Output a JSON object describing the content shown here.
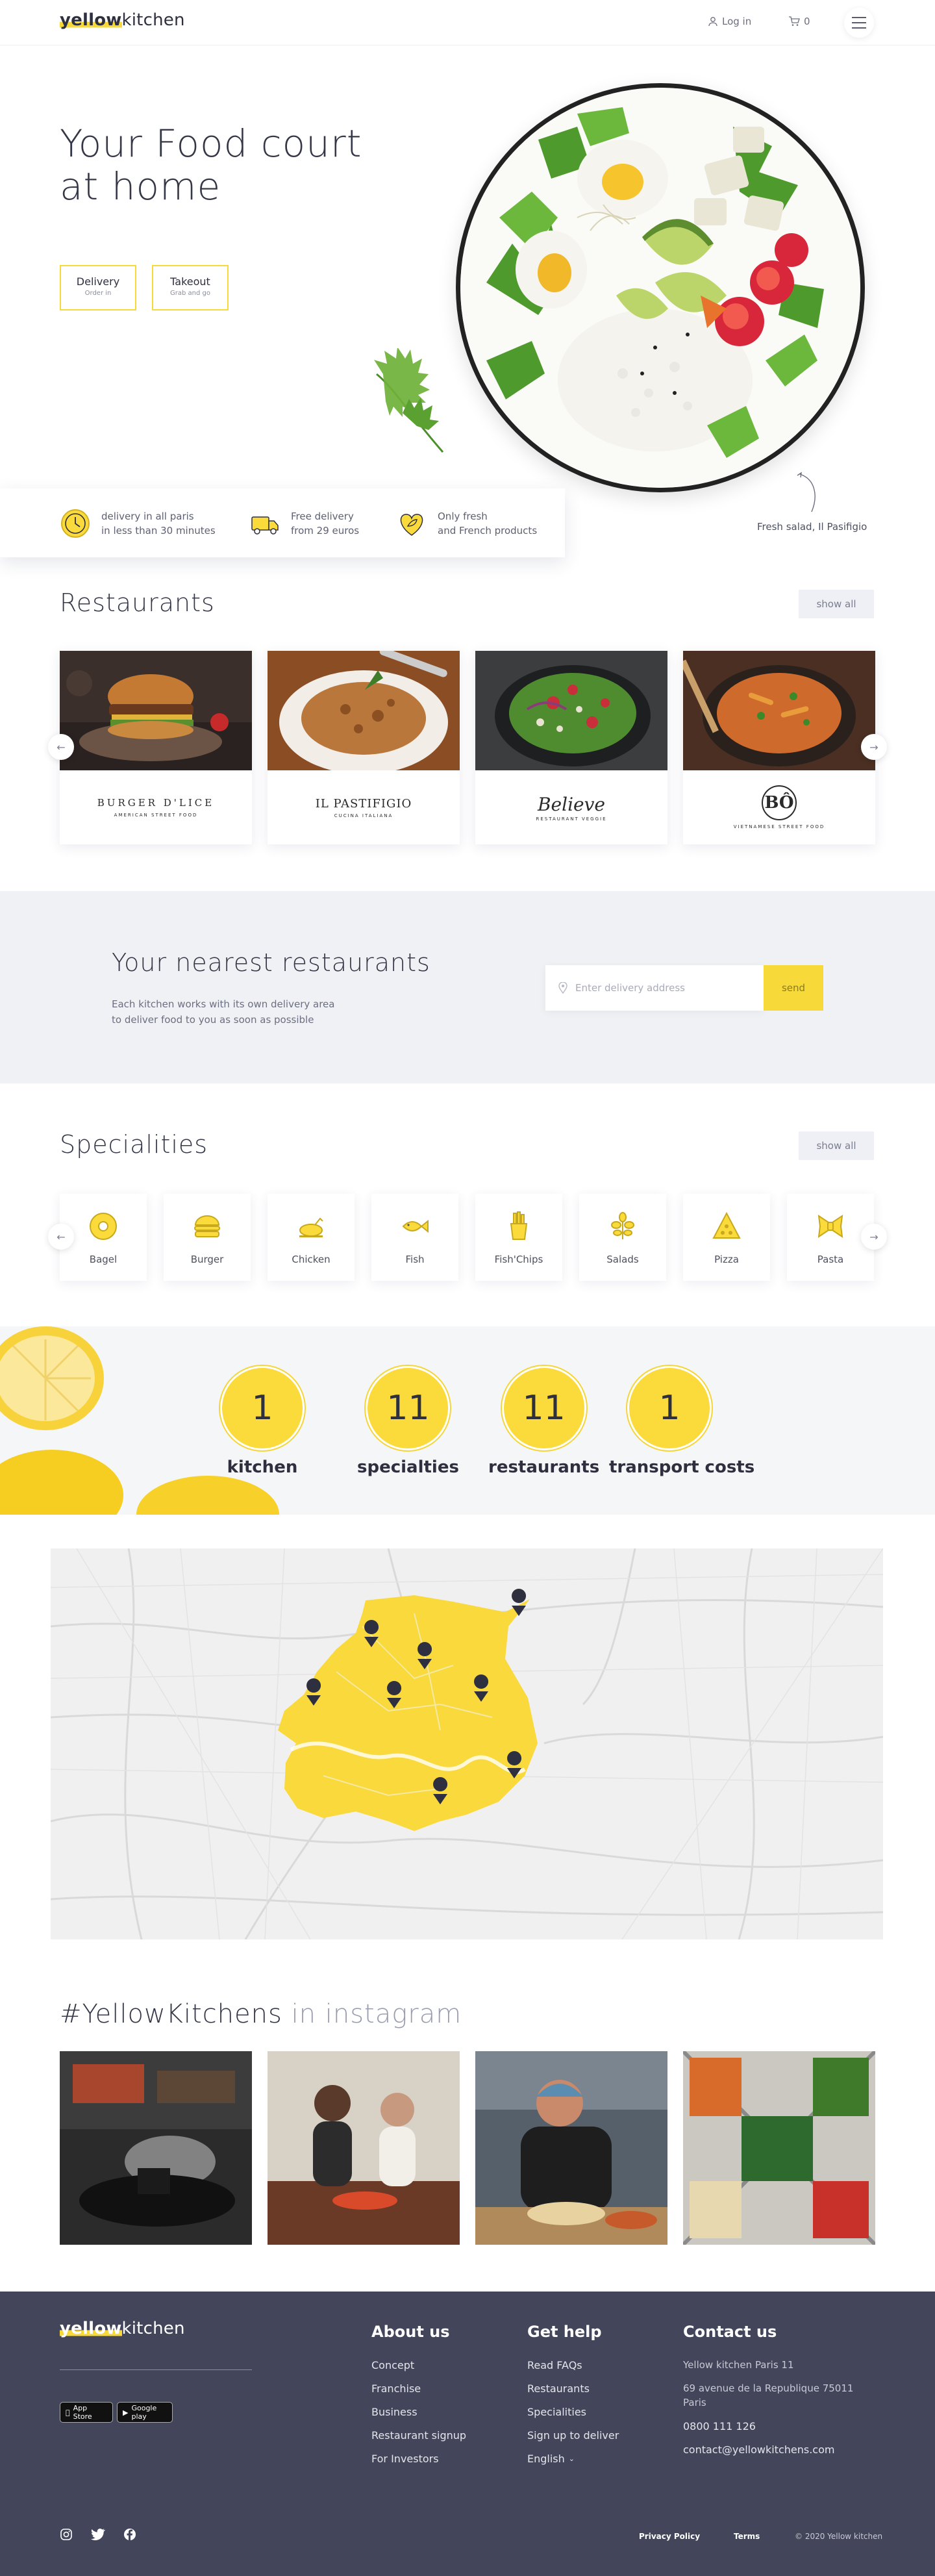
{
  "header": {
    "logo_bold": "yellow",
    "logo_rest": "kitchen",
    "login": "Log in",
    "cart_count": "0"
  },
  "hero": {
    "title": "Your Food court at home",
    "buttons": [
      {
        "label": "Delivery",
        "sub": "Order in"
      },
      {
        "label": "Takeout",
        "sub": "Grab and go"
      }
    ],
    "caption": "Fresh salad, Il Pasifigio",
    "features": [
      {
        "line1": "delivery in all paris",
        "line2": "in less than 30 minutes",
        "icon": "clock-icon"
      },
      {
        "line1": "Free delivery",
        "line2": "from 29 euros",
        "icon": "delivery-truck-icon"
      },
      {
        "line1": "Only fresh",
        "line2": "and French products",
        "icon": "heart-leaf-icon"
      }
    ]
  },
  "restaurants": {
    "title": "Restaurants",
    "show_all": "show all",
    "items": [
      {
        "name": "BURGER D'LICE",
        "tag": "AMERICAN STREET FOOD"
      },
      {
        "name": "IL PASTIFIGIO",
        "tag": "CUCINA ITALIANA"
      },
      {
        "name": "Believe",
        "tag": "RESTAURANT VEGGIE"
      },
      {
        "name": "BÔ",
        "tag": "VIETNAMESE STREET FOOD"
      }
    ]
  },
  "nearest": {
    "title": "Your nearest restaurants",
    "desc1": "Each kitchen works with its own delivery area",
    "desc2": "to deliver food to you as soon as possible",
    "placeholder": "Enter delivery address",
    "send": "send"
  },
  "specialities": {
    "title": "Specialities",
    "show_all": "show all",
    "items": [
      {
        "label": "Bagel",
        "icon": "bagel-icon"
      },
      {
        "label": "Burger",
        "icon": "burger-icon"
      },
      {
        "label": "Chicken",
        "icon": "chicken-icon"
      },
      {
        "label": "Fish",
        "icon": "fish-icon"
      },
      {
        "label": "Fish'Chips",
        "icon": "fries-icon"
      },
      {
        "label": "Salads",
        "icon": "salad-icon"
      },
      {
        "label": "Pizza",
        "icon": "pizza-icon"
      },
      {
        "label": "Pasta",
        "icon": "pasta-icon"
      }
    ]
  },
  "stats": [
    {
      "value": "1",
      "label": "kitchen"
    },
    {
      "value": "11",
      "label": "specialties"
    },
    {
      "value": "11",
      "label": "restaurants"
    },
    {
      "value": "1",
      "label": "transport costs"
    }
  ],
  "instagram": {
    "title": "#YellowKitchens",
    "title_light": "in instagram"
  },
  "footer": {
    "about": {
      "title": "About us",
      "links": [
        "Concept",
        "Franchise",
        "Business",
        "Restaurant signup",
        "For Investors"
      ]
    },
    "help": {
      "title": "Get help",
      "links": [
        "Read FAQs",
        "Restaurants",
        "Specialities",
        "Sign up to deliver",
        "English"
      ]
    },
    "contact": {
      "title": "Contact us",
      "name": "Yellow kitchen Paris 11",
      "address1": "69 avenue de la Republique 75011",
      "address2": "Paris",
      "phone": "0800 111 126",
      "email": "contact@yellowkitchens.com"
    },
    "app_store": "App Store",
    "google_play": "Google play",
    "privacy": "Privacy Policy",
    "terms": "Terms",
    "copyright": "© 2020 Yellow kitchen"
  },
  "colors": {
    "accent": "#f8d93a",
    "footer_bg": "#43455a",
    "text": "#353747"
  }
}
